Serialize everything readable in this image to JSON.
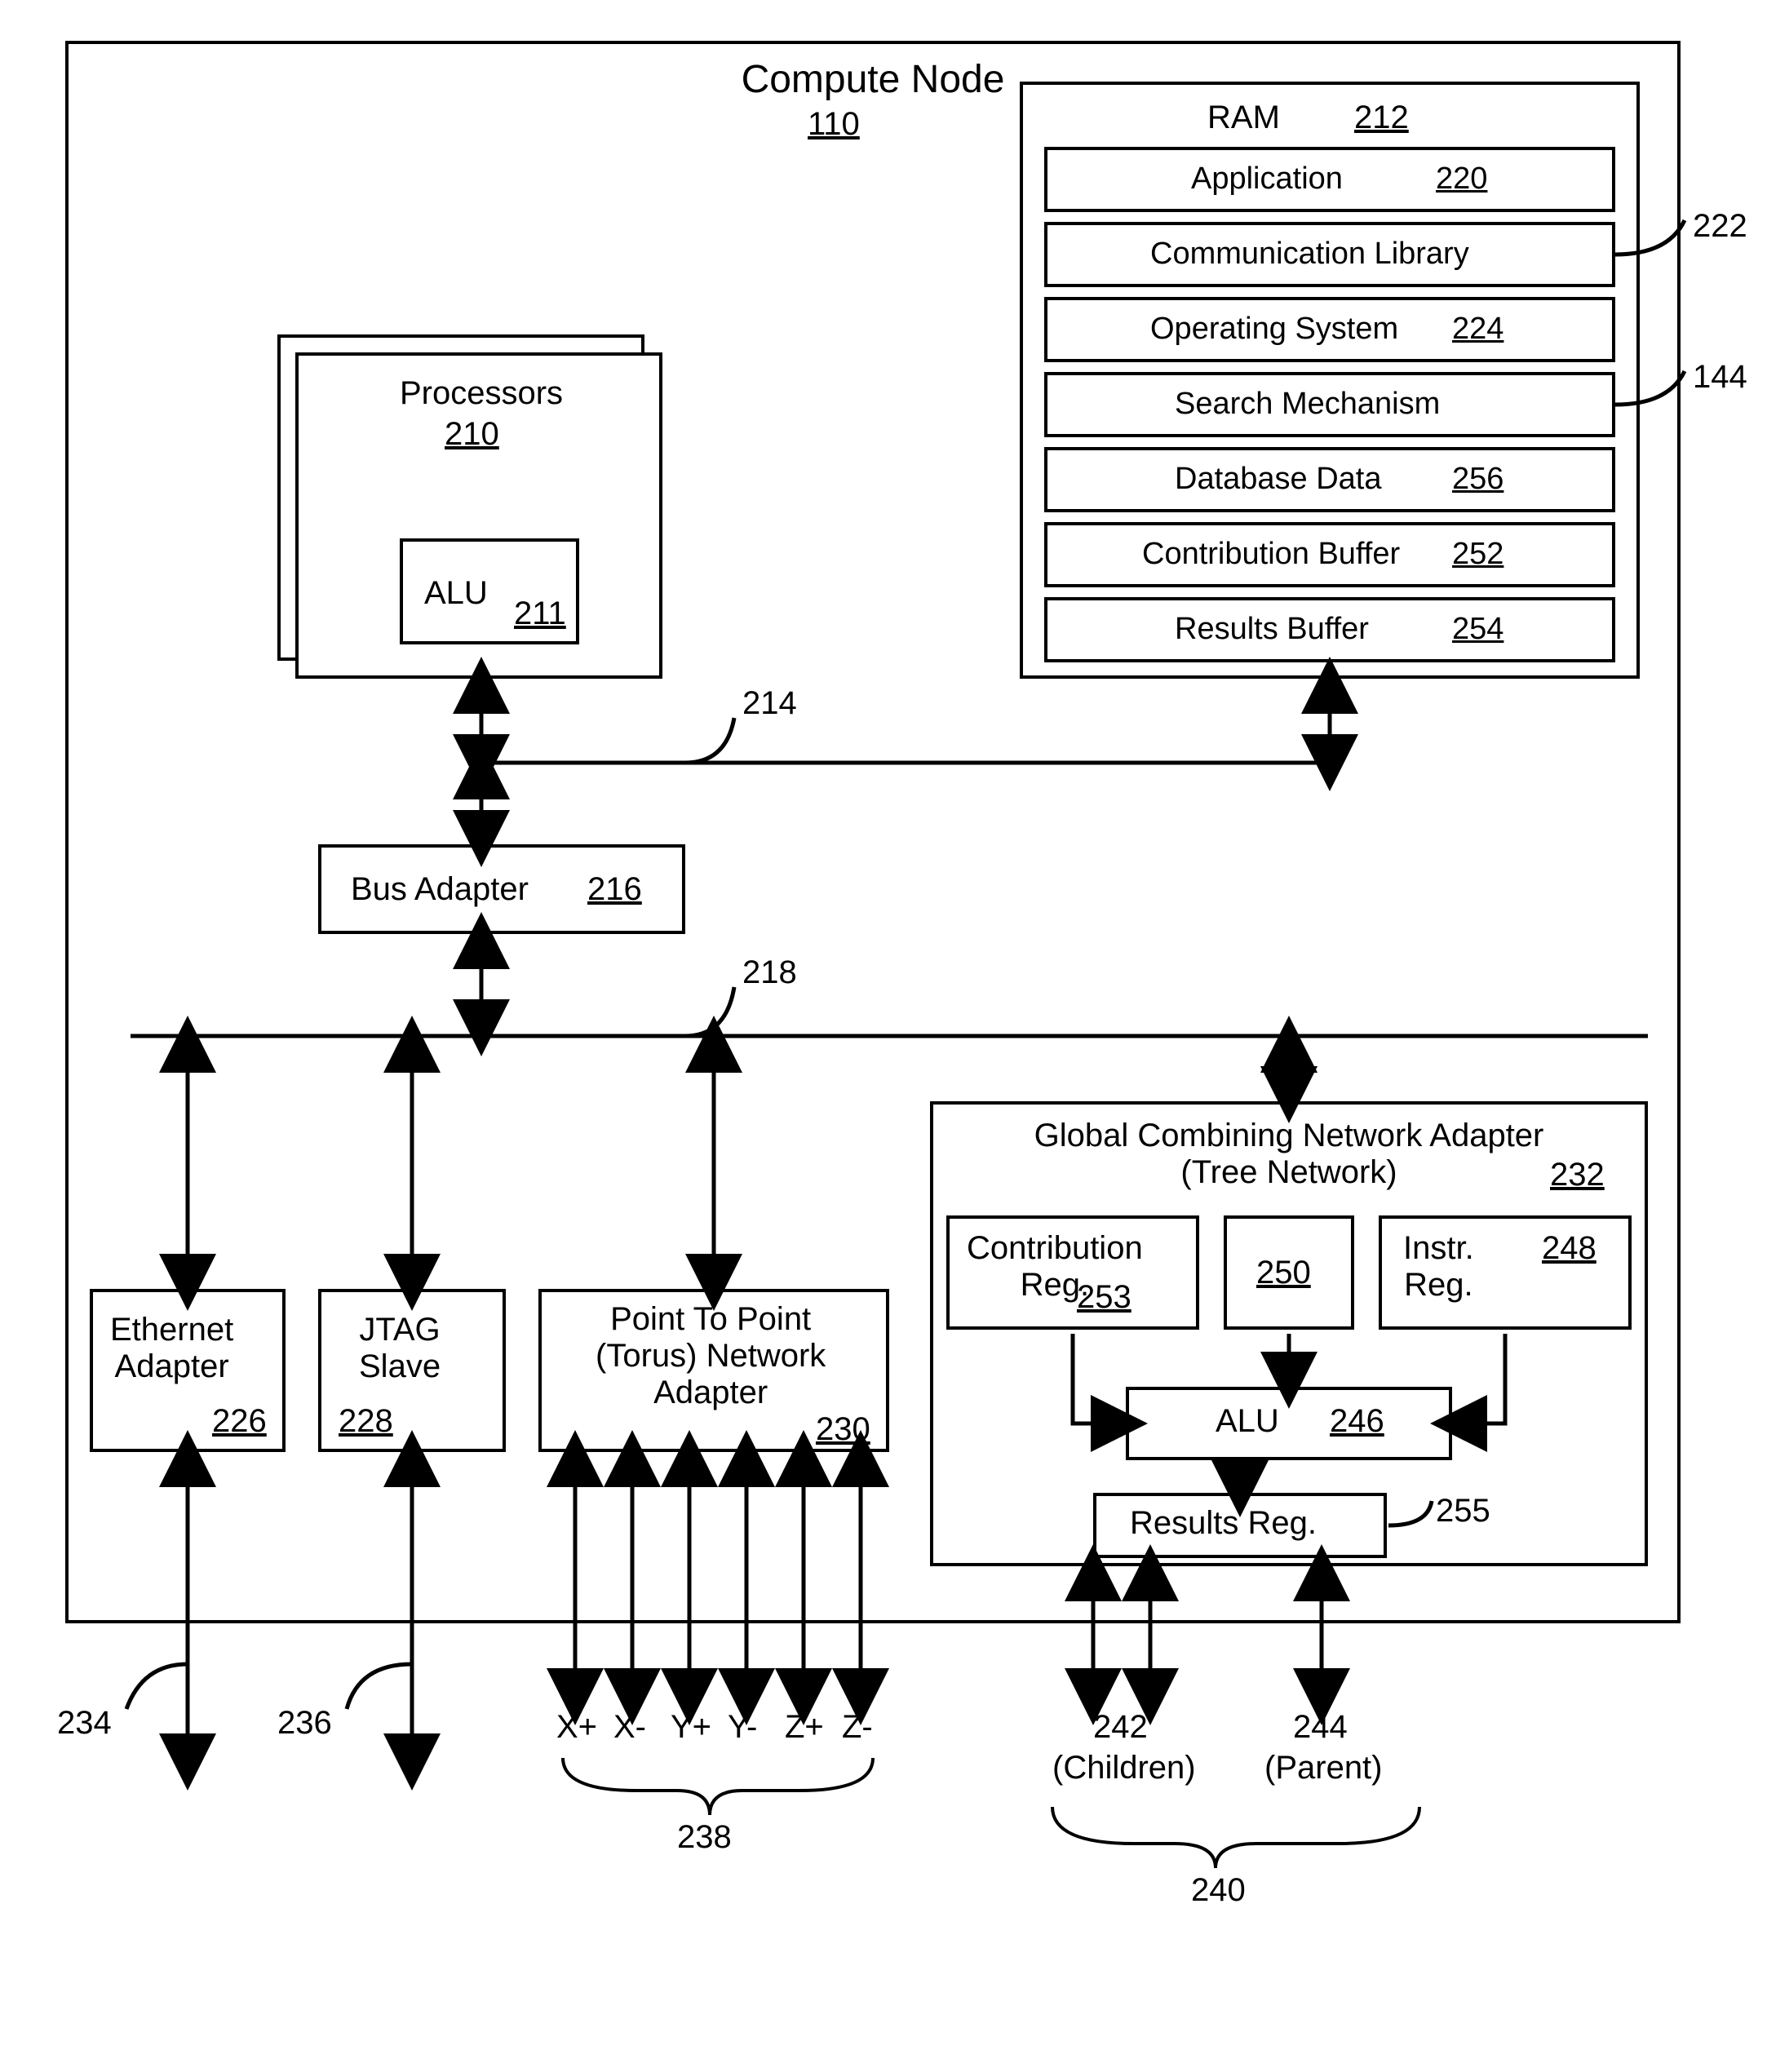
{
  "title": {
    "text": "Compute Node",
    "ref": "110"
  },
  "processors": {
    "text": "Processors",
    "ref": "210",
    "alu": {
      "text": "ALU",
      "ref": "211"
    }
  },
  "ram": {
    "text": "RAM",
    "ref": "212",
    "items": [
      {
        "text": "Application",
        "ref": "220"
      },
      {
        "text": "Communication Library",
        "refout": "222"
      },
      {
        "text": "Operating System",
        "ref": "224"
      },
      {
        "text": "Search Mechanism",
        "refout": "144"
      },
      {
        "text": "Database Data",
        "ref": "256"
      },
      {
        "text": "Contribution Buffer",
        "ref": "252"
      },
      {
        "text": "Results Buffer",
        "ref": "254"
      }
    ]
  },
  "bus": {
    "text": "Bus Adapter",
    "ref": "216"
  },
  "eth": {
    "text": "Ethernet\nAdapter",
    "ref": "226"
  },
  "jtag": {
    "text": "JTAG\nSlave",
    "ref": "228"
  },
  "p2p": {
    "text": "Point To Point\n(Torus) Network\nAdapter",
    "ref": "230"
  },
  "gcna": {
    "text": "Global Combining Network Adapter\n(Tree Network)",
    "ref": "232",
    "contrib": {
      "text": "Contribution\nReg.",
      "ref": "253"
    },
    "mid": {
      "ref": "250"
    },
    "instr": {
      "text": "Instr.\nReg.",
      "ref": "248"
    },
    "alu": {
      "text": "ALU",
      "ref": "246"
    },
    "results": {
      "text": "Results Reg.",
      "ref": "255"
    }
  },
  "refs": {
    "r214": "214",
    "r218": "218",
    "r234": "234",
    "r236": "236"
  },
  "torus": {
    "labels": [
      "X+",
      "X-",
      "Y+",
      "Y-",
      "Z+",
      "Z-"
    ],
    "group": "238"
  },
  "tree": {
    "children": {
      "ref": "242",
      "text": "(Children)"
    },
    "parent": {
      "ref": "244",
      "text": "(Parent)"
    },
    "group": "240"
  }
}
